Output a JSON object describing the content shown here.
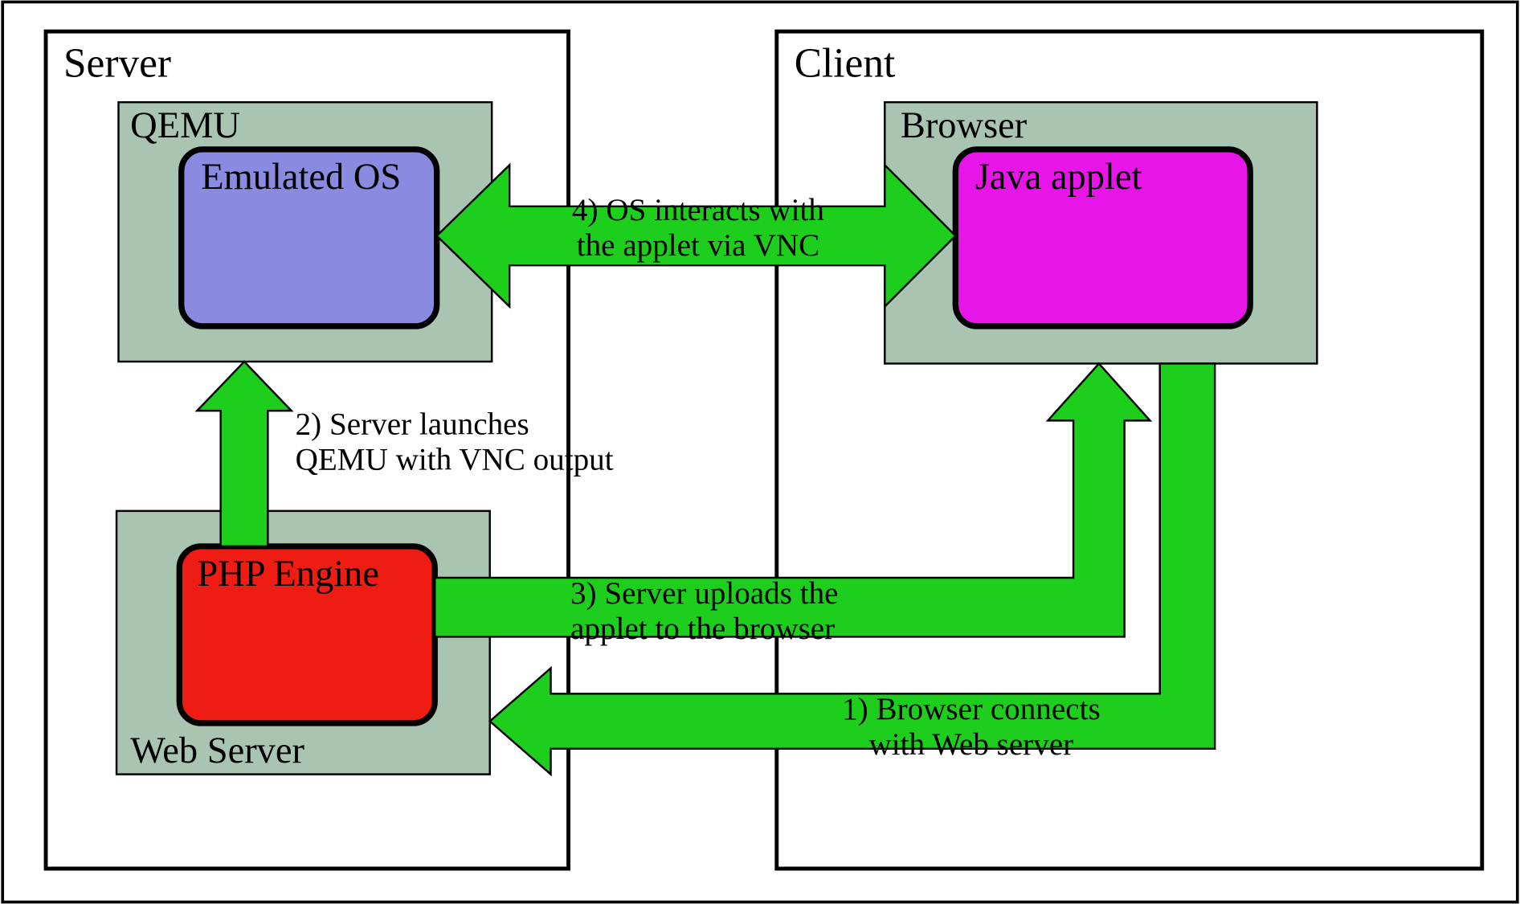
{
  "server": {
    "title": "Server",
    "qemu": {
      "title": "QEMU",
      "emulated_os": "Emulated OS"
    },
    "webserver": {
      "title": "Web Server",
      "php": "PHP Engine"
    }
  },
  "client": {
    "title": "Client",
    "browser": {
      "title": "Browser",
      "applet": "Java applet"
    }
  },
  "arrows": {
    "step1_line1": "1) Browser connects",
    "step1_line2": "with Web server",
    "step2_line1": "2) Server launches",
    "step2_line2": "QEMU with VNC output",
    "step3_line1": "3) Server uploads the",
    "step3_line2": "applet to the browser",
    "step4_line1": "4) OS interacts with",
    "step4_line2": "the applet via VNC"
  },
  "colors": {
    "sage": "#a9c5b1",
    "purple": "#8a8ae0",
    "magenta": "#e815e8",
    "red": "#ee1c12",
    "green": "#1dce1d",
    "black": "#000000"
  }
}
